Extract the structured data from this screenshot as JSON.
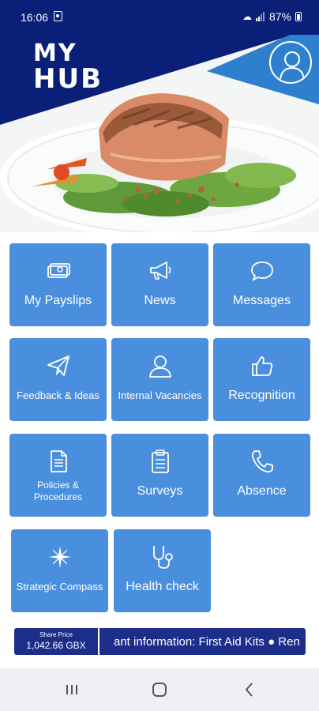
{
  "status_bar": {
    "time": "16:06",
    "battery": "87%",
    "icons": [
      "notification-icon",
      "wifi-icon",
      "signal-icon",
      "battery-icon"
    ]
  },
  "header": {
    "brand_line1": "MY",
    "brand_line2": "HUB",
    "avatar_icon": "user-icon",
    "colors": {
      "navy": "#0a1f78",
      "accent_blue": "#2e80cf",
      "tile_blue": "#4a8fde"
    }
  },
  "tiles": [
    {
      "label": "My Payslips",
      "icon": "payslip-icon"
    },
    {
      "label": "News",
      "icon": "megaphone-icon"
    },
    {
      "label": "Messages",
      "icon": "chat-bubble-icon"
    },
    {
      "label": "Feedback & Ideas",
      "icon": "paper-plane-icon"
    },
    {
      "label": "Internal Vacancies",
      "icon": "person-icon"
    },
    {
      "label": "Recognition",
      "icon": "thumbs-up-icon"
    },
    {
      "label": "Policies & Procedures",
      "icon": "document-icon"
    },
    {
      "label": "Surveys",
      "icon": "clipboard-icon"
    },
    {
      "label": "Absence",
      "icon": "phone-icon"
    },
    {
      "label": "Strategic Compass",
      "icon": "compass-icon"
    },
    {
      "label": "Health check",
      "icon": "stethoscope-icon"
    }
  ],
  "ticker": {
    "share_caption": "Share Price",
    "share_value": "1,042.66 GBX",
    "text": "ant information: First Aid Kits   ●   Ren"
  },
  "navbar": {
    "buttons": [
      "recents-icon",
      "home-icon",
      "back-icon"
    ]
  }
}
